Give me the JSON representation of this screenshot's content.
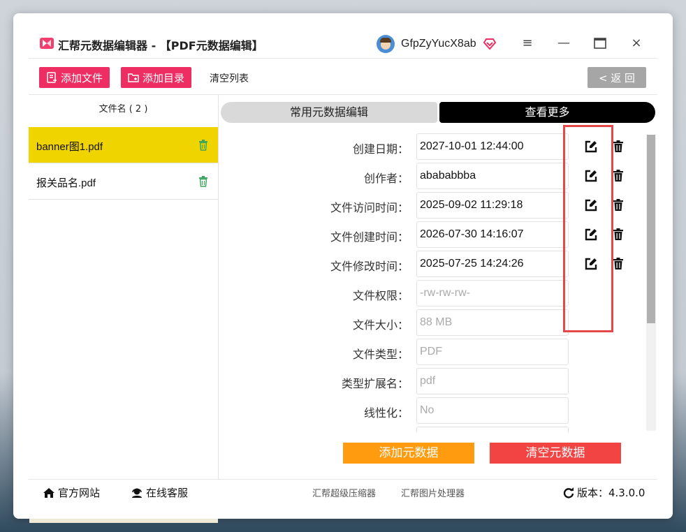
{
  "app": {
    "title": "汇帮元数据编辑器 - 【PDF元数据编辑】",
    "username": "GfpZyYucX8ab",
    "accent_color": "#ee2e63"
  },
  "window_controls": {
    "menu": "≡",
    "minimize": "—",
    "maximize": "▭",
    "close": "×"
  },
  "toolbar": {
    "add_file": "添加文件",
    "add_dir": "添加目录",
    "clear_list": "清空列表",
    "back": "< 返 回"
  },
  "sidebar": {
    "header": "文件名 ( 2 )",
    "files": [
      {
        "name": "banner图1.pdf",
        "active": true
      },
      {
        "name": "报关品名.pdf",
        "active": false
      }
    ]
  },
  "tabs": {
    "common": "常用元数据编辑",
    "more": "查看更多"
  },
  "metadata": [
    {
      "label": "创建日期：",
      "value": "2027-10-01 12:44:00",
      "editable": true
    },
    {
      "label": "创作者：",
      "value": "abababbba",
      "editable": true
    },
    {
      "label": "文件访问时间：",
      "value": "2025-09-02 11:29:18",
      "editable": true
    },
    {
      "label": "文件创建时间：",
      "value": "2026-07-30 14:16:07",
      "editable": true
    },
    {
      "label": "文件修改时间：",
      "value": "2025-07-25 14:24:26",
      "editable": true
    },
    {
      "label": "文件权限：",
      "value": "-rw-rw-rw-",
      "editable": false
    },
    {
      "label": "文件大小：",
      "value": "88 MB",
      "editable": false
    },
    {
      "label": "文件类型：",
      "value": "PDF",
      "editable": false
    },
    {
      "label": "类型扩展名：",
      "value": "pdf",
      "editable": false
    },
    {
      "label": "线性化：",
      "value": "No",
      "editable": false
    }
  ],
  "actions": {
    "add_meta": "添加元数据",
    "clear_meta": "清空元数据"
  },
  "footer": {
    "official_site": "官方网站",
    "online_service": "在线客服",
    "compressor": "汇帮超级压缩器",
    "image_tool": "汇帮图片处理器",
    "version": "版本：4.3.0.0"
  }
}
